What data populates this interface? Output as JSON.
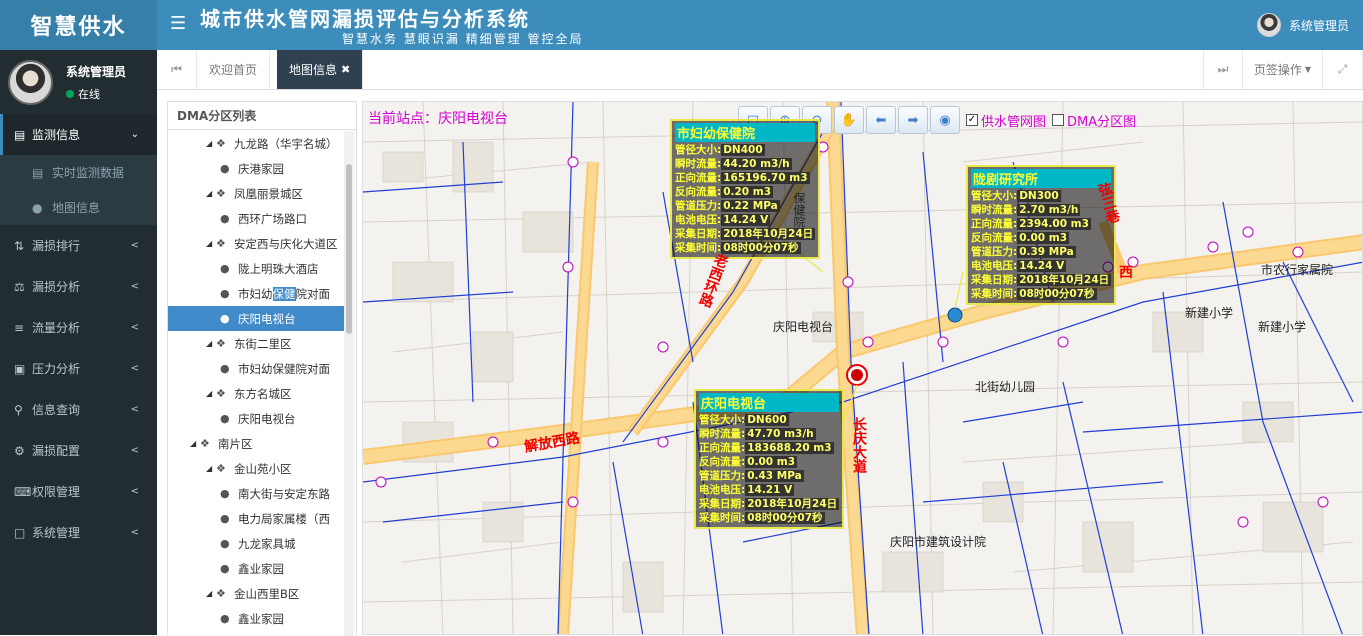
{
  "app": {
    "logo": "智慧供水",
    "title": "城市供水管网漏损评估与分析系统",
    "subtitle": "智慧水务 慧眼识漏 精细管理 管控全局",
    "menu_icon": "bars-icon"
  },
  "user": {
    "name": "系统管理员",
    "status": "在线"
  },
  "sidebar": {
    "items": [
      {
        "label": "监测信息",
        "icon": "book-icon",
        "active": true
      },
      {
        "label": "漏损排行",
        "icon": "sort-icon"
      },
      {
        "label": "漏损分析",
        "icon": "balance-icon"
      },
      {
        "label": "流量分析",
        "icon": "list-icon"
      },
      {
        "label": "压力分析",
        "icon": "file-icon"
      },
      {
        "label": "信息查询",
        "icon": "search-icon"
      },
      {
        "label": "漏损配置",
        "icon": "gears-icon"
      },
      {
        "label": "权限管理",
        "icon": "keyboard-icon"
      },
      {
        "label": "系统管理",
        "icon": "desktop-icon"
      }
    ],
    "sub": [
      {
        "label": "实时监测数据",
        "icon": "monitor-icon"
      },
      {
        "label": "地图信息",
        "icon": "globe-icon"
      }
    ]
  },
  "tabs": {
    "items": [
      "欢迎首页",
      "地图信息"
    ],
    "page_ops": "页签操作"
  },
  "dma": {
    "title": "DMA分区列表",
    "rows": [
      {
        "label": "九龙路（华宇名城）",
        "level": 1,
        "type": "region"
      },
      {
        "label": "庆港家园",
        "level": 2,
        "type": "point"
      },
      {
        "label": "凤凰丽景城区",
        "level": 1,
        "type": "region"
      },
      {
        "label": "西环广场路口",
        "level": 2,
        "type": "point"
      },
      {
        "label": "安定西与庆化大道区",
        "level": 1,
        "type": "region"
      },
      {
        "label": "陇上明珠大酒店",
        "level": 2,
        "type": "point"
      },
      {
        "label": "市妇幼保健院对面",
        "level": 2,
        "type": "point"
      },
      {
        "label": "庆阳电视台",
        "level": 2,
        "type": "point",
        "selected": true
      },
      {
        "label": "东街二里区",
        "level": 1,
        "type": "region"
      },
      {
        "label": "市妇幼保健院对面",
        "level": 2,
        "type": "point"
      },
      {
        "label": "东方名城区",
        "level": 1,
        "type": "region"
      },
      {
        "label": "庆阳电视台",
        "level": 2,
        "type": "point"
      },
      {
        "label": "南片区",
        "level": 0,
        "type": "region"
      },
      {
        "label": "金山苑小区",
        "level": 1,
        "type": "region"
      },
      {
        "label": "南大街与安定东路",
        "level": 2,
        "type": "point"
      },
      {
        "label": "电力局家属楼（西",
        "level": 2,
        "type": "point"
      },
      {
        "label": "九龙家具城",
        "level": 2,
        "type": "point"
      },
      {
        "label": "鑫业家园",
        "level": 2,
        "type": "point"
      },
      {
        "label": "金山西里B区",
        "level": 1,
        "type": "region"
      },
      {
        "label": "鑫业家园",
        "level": 2,
        "type": "point"
      }
    ]
  },
  "map": {
    "station": "当前站点：庆阳电视台",
    "toolbar": [
      "pan-icon",
      "zoom-in-icon",
      "zoom-out-icon",
      "hand-icon",
      "back-icon",
      "forward-icon",
      "globe-icon"
    ],
    "layers": [
      {
        "label": "供水管网图",
        "checked": true
      },
      {
        "label": "DMA分区图",
        "checked": false
      }
    ],
    "infoboxes": [
      {
        "title": "市妇幼保健院",
        "lines": [
          [
            "管径大小:",
            "DN400"
          ],
          [
            "瞬时流量:",
            "44.20 m3/h"
          ],
          [
            "正向流量:",
            "165196.70 m3"
          ],
          [
            "反向流量:",
            "0.20 m3"
          ],
          [
            "管道压力:",
            "0.22 MPa"
          ],
          [
            "电池电压:",
            "14.24 V"
          ],
          [
            "采集日期:",
            "2018年10月24日"
          ],
          [
            "采集时间:",
            "08时00分07秒"
          ]
        ]
      },
      {
        "title": "陇剧研究所",
        "lines": [
          [
            "管径大小:",
            "DN300"
          ],
          [
            "瞬时流量:",
            "2.70 m3/h"
          ],
          [
            "正向流量:",
            "2394.00 m3"
          ],
          [
            "反向流量:",
            "0.00 m3"
          ],
          [
            "管道压力:",
            "0.39 MPa"
          ],
          [
            "电池电压:",
            "14.24 V"
          ],
          [
            "采集日期:",
            "2018年10月24日"
          ],
          [
            "采集时间:",
            "08时00分07秒"
          ]
        ]
      },
      {
        "title": "庆阳电视台",
        "lines": [
          [
            "管径大小:",
            "DN600"
          ],
          [
            "瞬时流量:",
            "47.70 m3/h"
          ],
          [
            "正向流量:",
            "183688.20 m3"
          ],
          [
            "反向流量:",
            "0.00 m3"
          ],
          [
            "管道压力:",
            "0.43 MPa"
          ],
          [
            "电池电压:",
            "14.21 V"
          ],
          [
            "采集日期:",
            "2018年10月24日"
          ],
          [
            "采集时间:",
            "08时00分07秒"
          ]
        ]
      }
    ],
    "places": [
      "庆阳电视台",
      "北街幼儿园",
      "新建小学",
      "新建小学",
      "市农行家属院",
      "庆阳市建筑设计院",
      "保健院"
    ],
    "roads": [
      "解放西路",
      "长庆大道",
      "老西环路",
      "弦三巷",
      "西"
    ]
  }
}
